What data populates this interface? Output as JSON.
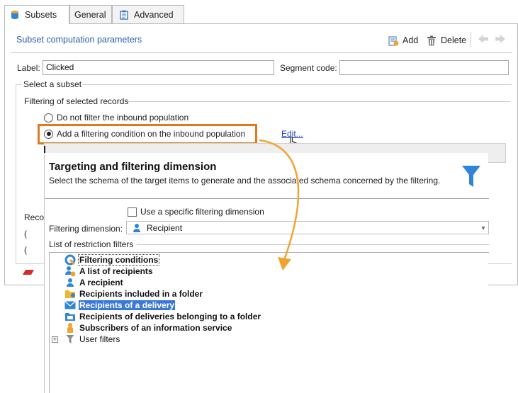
{
  "tabs": [
    {
      "label": "Subsets",
      "icon": "database-icon",
      "active": true
    },
    {
      "label": "General",
      "icon": "",
      "active": false
    },
    {
      "label": "Advanced",
      "icon": "clipboard-icon",
      "active": false
    }
  ],
  "toolbar": {
    "title": "Subset computation parameters",
    "add_label": "Add",
    "delete_label": "Delete"
  },
  "form": {
    "label_caption": "Label:",
    "label_value": "Clicked",
    "segment_caption": "Segment code:",
    "segment_value": "",
    "select_subset": "Select a subset",
    "filtering_title": "Filtering of selected records",
    "radio_no_filter": "Do not filter the inbound population",
    "radio_add_condition": "Add a filtering condition on the inbound population",
    "edit_link": "Edit...",
    "truncated_reco": "Reco",
    "truncated_paren1": "(",
    "truncated_paren2": "("
  },
  "dialog": {
    "title": "Targeting and filtering dimension",
    "subtitle": "Select the schema of the target items to  generate and the associated schema concerned by the filtering.",
    "use_specific_label": "Use a specific filtering dimension",
    "filtering_dimension_caption": "Filtering dimension:",
    "filtering_dimension_value": "Recipient",
    "restriction_filters_title": "List of restriction filters",
    "filters": [
      {
        "label": "Filtering conditions",
        "icon": "filter-conditions-icon",
        "state": "focused"
      },
      {
        "label": "A list of recipients",
        "icon": "recipients-list-icon",
        "state": ""
      },
      {
        "label": "A recipient",
        "icon": "person-icon",
        "state": ""
      },
      {
        "label": "Recipients included in a folder",
        "icon": "folder-icon",
        "state": ""
      },
      {
        "label": "Recipients of a delivery",
        "icon": "envelope-icon",
        "state": "selected"
      },
      {
        "label": "Recipients of deliveries belonging to a folder",
        "icon": "folder-deliveries-icon",
        "state": ""
      },
      {
        "label": "Subscribers of an information service",
        "icon": "subscriber-icon",
        "state": ""
      },
      {
        "label": "User filters",
        "icon": "funnel-small-icon",
        "state": "normal"
      }
    ]
  },
  "colors": {
    "accent_orange": "#e07a1c",
    "selection_blue": "#3a78d8",
    "title_blue": "#2a5fae",
    "funnel_blue": "#2f86d6"
  }
}
